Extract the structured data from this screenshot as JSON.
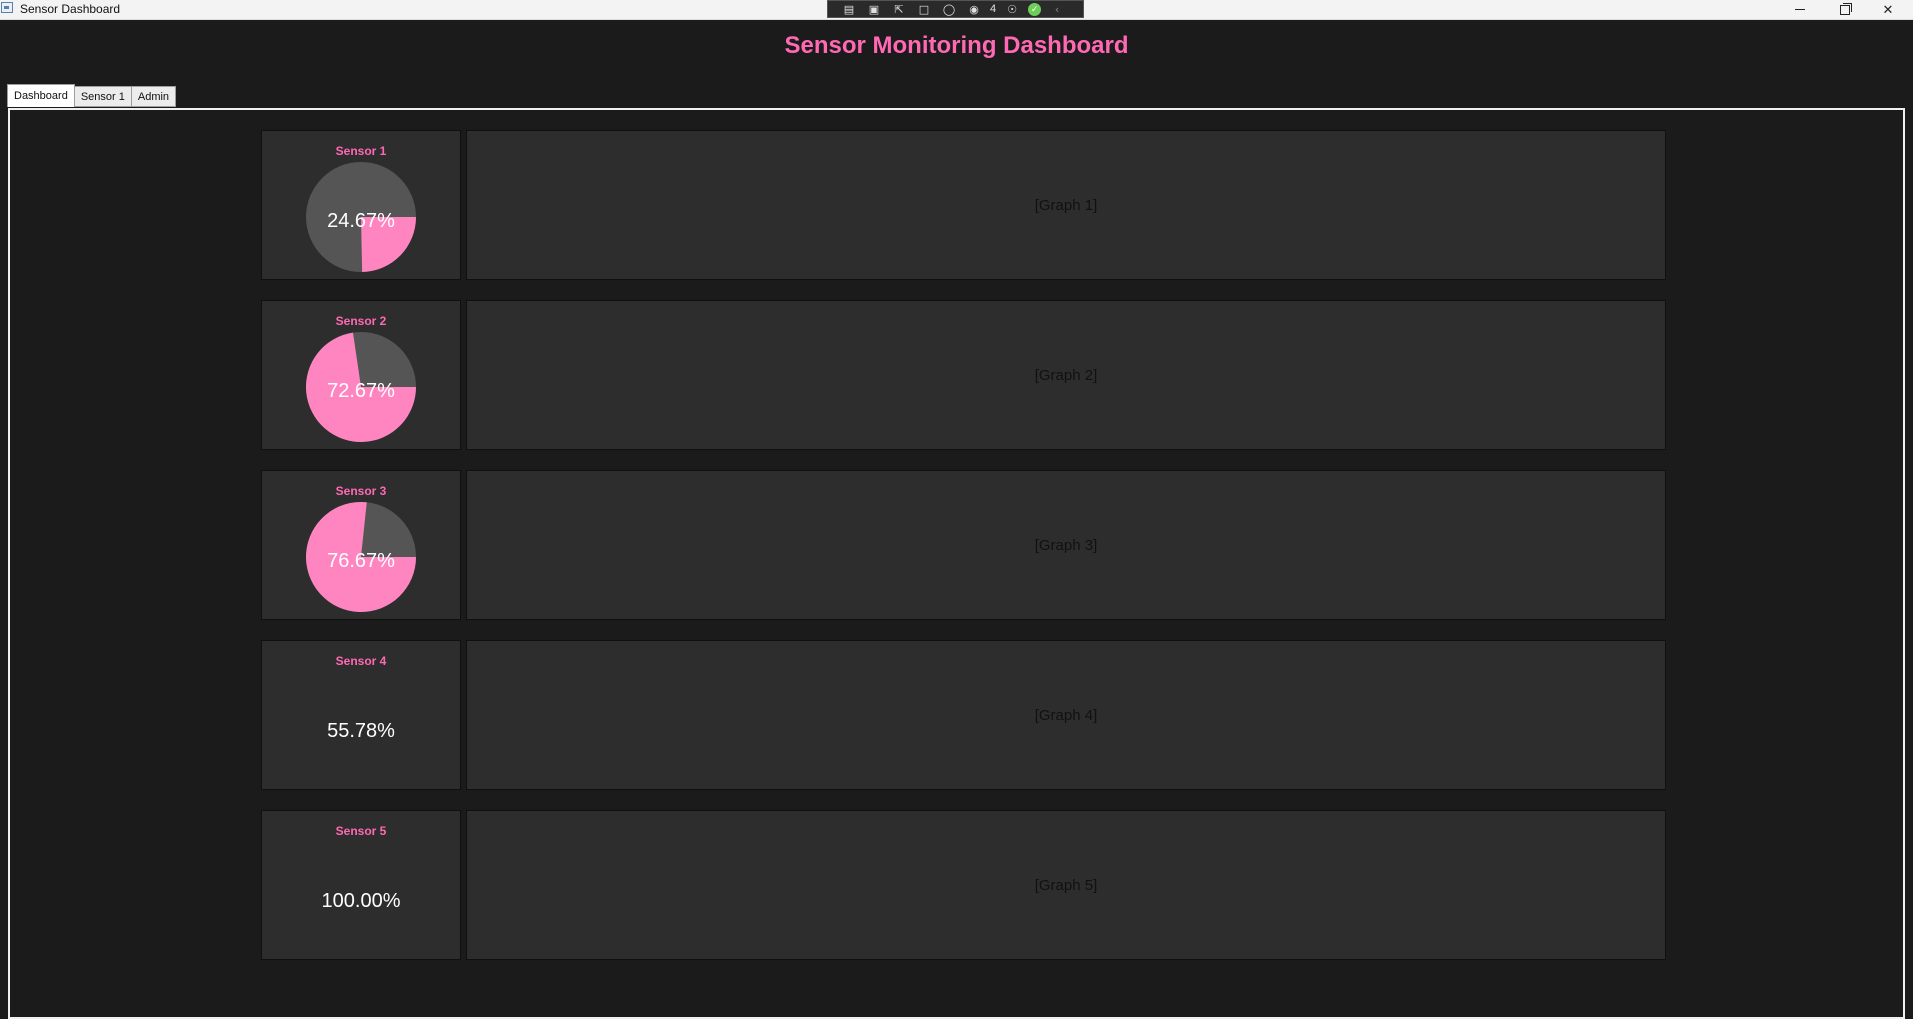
{
  "window": {
    "title": "Sensor Dashboard",
    "debug_toolbar": {
      "count": "4"
    }
  },
  "page": {
    "title": "Sensor Monitoring Dashboard"
  },
  "tabs": [
    {
      "label": "Dashboard",
      "active": true
    },
    {
      "label": "Sensor 1",
      "active": false
    },
    {
      "label": "Admin",
      "active": false
    }
  ],
  "colors": {
    "accent": "#ff69b4",
    "pie_fill": "#ff85c1",
    "pie_bg": "#555555",
    "card_bg": "#2d2d2d"
  },
  "sensors": [
    {
      "title": "Sensor 1",
      "percent_label": "24.67%",
      "fraction": 0.2467,
      "show_pie": true,
      "graph_label": "[Graph 1]"
    },
    {
      "title": "Sensor 2",
      "percent_label": "72.67%",
      "fraction": 0.7267,
      "show_pie": true,
      "graph_label": "[Graph 2]"
    },
    {
      "title": "Sensor 3",
      "percent_label": "76.67%",
      "fraction": 0.7667,
      "show_pie": true,
      "graph_label": "[Graph 3]"
    },
    {
      "title": "Sensor 4",
      "percent_label": "55.78%",
      "fraction": 0.5578,
      "show_pie": false,
      "graph_label": "[Graph 4]"
    },
    {
      "title": "Sensor 5",
      "percent_label": "100.00%",
      "fraction": 1.0,
      "show_pie": false,
      "graph_label": "[Graph 5]"
    }
  ]
}
